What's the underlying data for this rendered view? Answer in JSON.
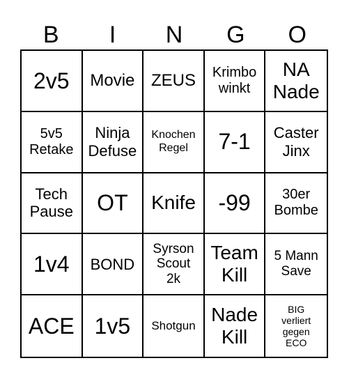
{
  "header": [
    "B",
    "I",
    "N",
    "G",
    "O"
  ],
  "rows": [
    [
      {
        "text": "2v5",
        "size": "xl"
      },
      {
        "text": "Movie",
        "size": "m"
      },
      {
        "text": "ZEUS",
        "size": "m"
      },
      {
        "text": "Krimbo\nwinkt",
        "size": "s"
      },
      {
        "text": "NA\nNade",
        "size": "l"
      }
    ],
    [
      {
        "text": "5v5\nRetake",
        "size": "s"
      },
      {
        "text": "Ninja\nDefuse",
        "size": "sm"
      },
      {
        "text": "Knochen\nRegel",
        "size": "xs"
      },
      {
        "text": "7-1",
        "size": "xl"
      },
      {
        "text": "Caster\nJinx",
        "size": "sm"
      }
    ],
    [
      {
        "text": "Tech\nPause",
        "size": "sm"
      },
      {
        "text": "OT",
        "size": "xl"
      },
      {
        "text": "Knife",
        "size": "l"
      },
      {
        "text": "-99",
        "size": "xl"
      },
      {
        "text": "30er\nBombe",
        "size": "s"
      }
    ],
    [
      {
        "text": "1v4",
        "size": "xl"
      },
      {
        "text": "BOND",
        "size": "sm"
      },
      {
        "text": "Syrson\nScout\n2k",
        "size": "s2"
      },
      {
        "text": "Team\nKill",
        "size": "l"
      },
      {
        "text": "5 Mann\nSave",
        "size": "s2"
      }
    ],
    [
      {
        "text": "ACE",
        "size": "xl"
      },
      {
        "text": "1v5",
        "size": "xl"
      },
      {
        "text": "Shotgun",
        "size": "xs2"
      },
      {
        "text": "Nade\nKill",
        "size": "l"
      },
      {
        "text": "BIG\nverliert\ngegen\nECO",
        "size": "xxs"
      }
    ]
  ]
}
